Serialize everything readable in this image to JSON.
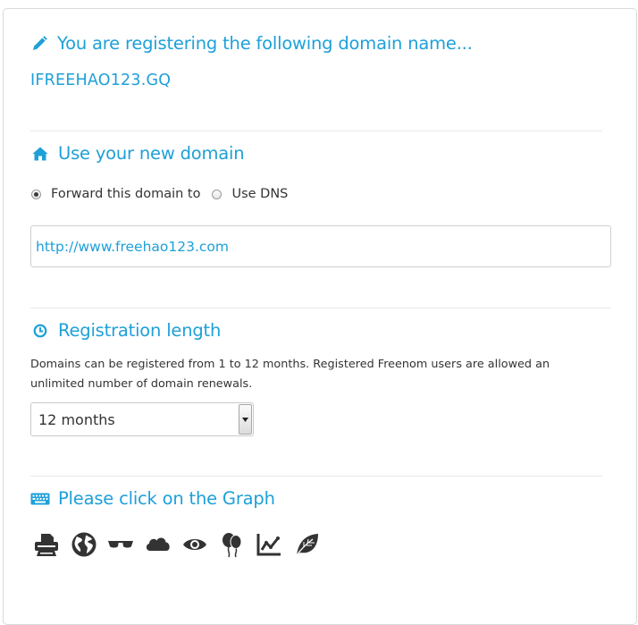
{
  "header": {
    "title": "You are registering the following domain name...",
    "domain": "IFREEHAO123.GQ"
  },
  "use_domain": {
    "title": "Use your new domain",
    "forward_label": "Forward this domain to",
    "dns_label": "Use DNS",
    "selected": "forward",
    "url_value": "http://www.freehao123.com"
  },
  "registration": {
    "title": "Registration length",
    "description": "Domains can be registered from 1 to 12 months. Registered Freenom users are allowed an unlimited number of domain renewals.",
    "selected_period": "12 months"
  },
  "captcha": {
    "title": "Please click on the Graph",
    "icons": [
      "printer-icon",
      "globe-icon",
      "sunglasses-icon",
      "cloud-icon",
      "eye-icon",
      "balloons-icon",
      "graph-icon",
      "leaf-icon"
    ]
  },
  "colors": {
    "accent": "#1ea0d8",
    "text": "#333333",
    "icon": "#333333"
  }
}
